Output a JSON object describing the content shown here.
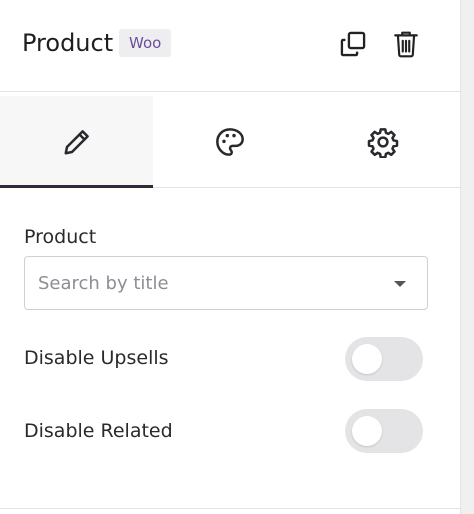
{
  "header": {
    "title": "Product",
    "badge": "Woo",
    "icons": {
      "duplicate": "copy-icon",
      "delete": "trash-icon"
    }
  },
  "tabs": [
    {
      "name": "content",
      "icon": "pencil-icon",
      "active": true
    },
    {
      "name": "style",
      "icon": "palette-icon",
      "active": false
    },
    {
      "name": "advanced",
      "icon": "gear-icon",
      "active": false
    }
  ],
  "product_field": {
    "label": "Product",
    "placeholder": "Search by title"
  },
  "toggles": [
    {
      "label": "Disable Upsells",
      "on": false
    },
    {
      "label": "Disable Related",
      "on": false
    }
  ],
  "colors": {
    "badge_text": "#6a4f9a",
    "active_tab_underline": "#2b2d3a",
    "toggle_off": "#e4e4e7"
  }
}
